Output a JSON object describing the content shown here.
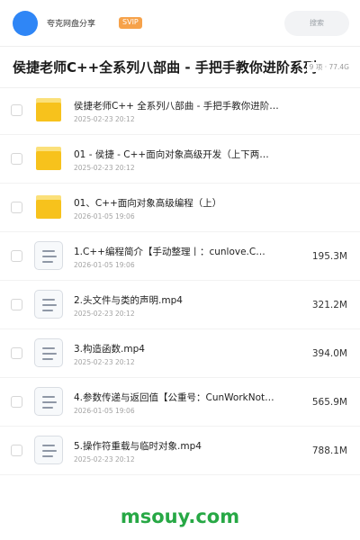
{
  "header": {
    "share_name": "夸克网盘分享",
    "badge": "SVIP",
    "search_placeholder": "搜索"
  },
  "folder": {
    "title": "侯捷老师C++全系列八部曲 - 手把手教你进阶系列",
    "meta": "9 项 · 77.4G"
  },
  "items": [
    {
      "type": "folder",
      "name": "侯捷老师C++ 全系列八部曲 - 手把手教你进阶系列",
      "date": "2025-02-23 20:12",
      "size": ""
    },
    {
      "type": "folder",
      "name": "01 - 侯捷 - C++面向对象高级开发（上下两…",
      "date": "2025-02-23 20:12",
      "size": ""
    },
    {
      "type": "folder",
      "name": "01、C++面向对象高级编程（上）",
      "date": "2026-01-05 19:06",
      "size": ""
    },
    {
      "type": "file",
      "name": "1.C++编程简介【手动整理丨：cunlove.C…",
      "date": "2026-01-05 19:06",
      "size": "195.3M"
    },
    {
      "type": "file",
      "name": "2.头文件与类的声明.mp4",
      "date": "2025-02-23 20:12",
      "size": "321.2M"
    },
    {
      "type": "file",
      "name": "3.构造函数.mp4",
      "date": "2025-02-23 20:12",
      "size": "394.0M"
    },
    {
      "type": "file",
      "name": "4.参数传递与返回值【公重号：CunWorkNot…",
      "date": "2026-01-05 19:06",
      "size": "565.9M"
    },
    {
      "type": "file",
      "name": "5.操作符重载与临时对象.mp4",
      "date": "2025-02-23 20:12",
      "size": "788.1M"
    }
  ],
  "watermark": "msouy.com",
  "colors": {
    "avatar": "#2f86f6",
    "badge": "#f6a24a",
    "folder": "#f7c21c",
    "watermark": "#27a845"
  },
  "icons": {
    "folder": "folder-icon",
    "file": "video-file-icon"
  }
}
